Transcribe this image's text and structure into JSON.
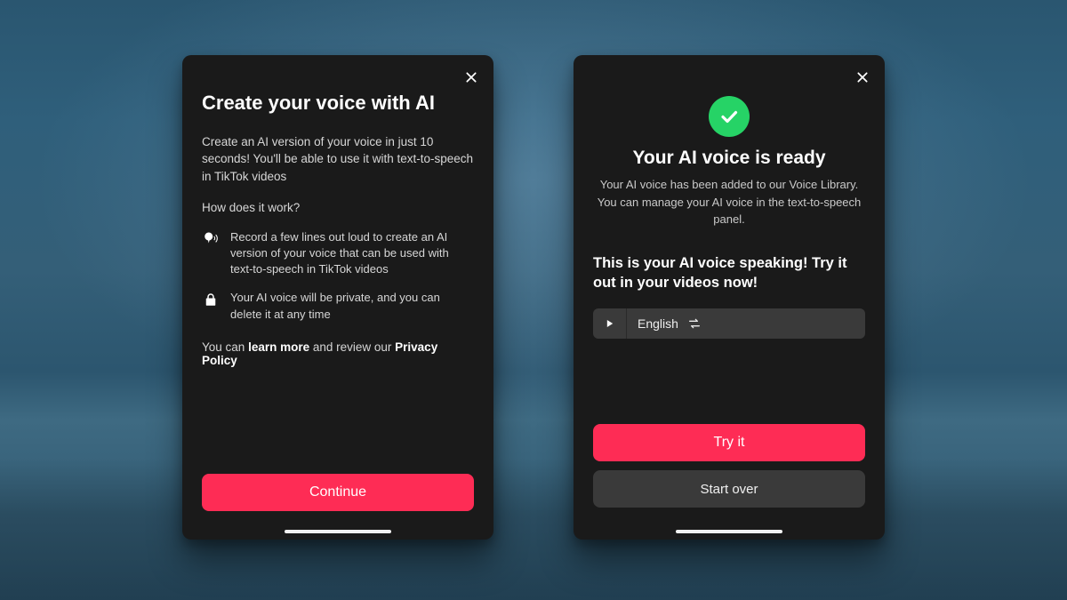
{
  "left": {
    "title": "Create your voice with AI",
    "intro": "Create an AI version of your voice in just 10 seconds! You'll be able to use it with text-to-speech in TikTok videos",
    "how_q": "How does it work?",
    "f1": "Record a few lines out loud to create an AI version of your voice that can be used with text-to-speech in TikTok videos",
    "f2": "Your AI voice will be private, and you can delete it at any time",
    "learn_pre": "You can ",
    "learn_more": "learn more",
    "learn_mid": " and review our ",
    "privacy": "Privacy Policy",
    "continue": "Continue"
  },
  "right": {
    "title": "Your AI voice is ready",
    "sub": "Your AI voice has been added to our Voice Library. You can manage your AI voice in the text-to-speech panel.",
    "speak": "This is your AI voice speaking! Try it out in your videos now!",
    "language": "English",
    "try": "Try it",
    "start_over": "Start over"
  }
}
